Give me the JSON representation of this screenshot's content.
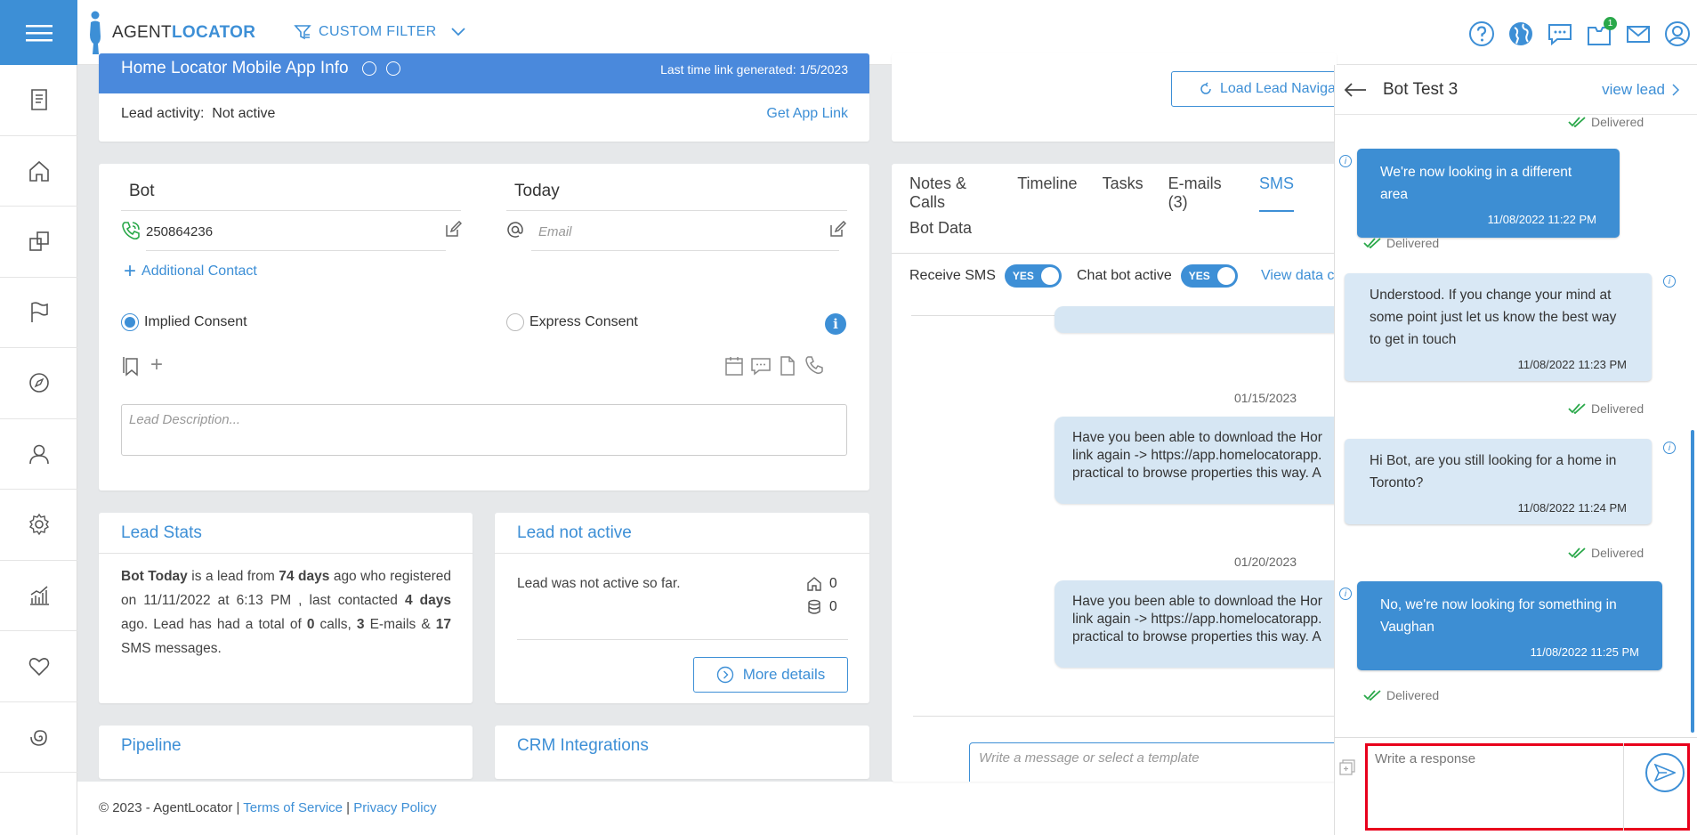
{
  "brand": {
    "part1": "AGENT",
    "part2": "LOCATOR"
  },
  "header": {
    "filter_label": "CUSTOM FILTER",
    "notification_count": "1"
  },
  "app_info": {
    "title": "Home Locator Mobile App Info",
    "last_link": "Last time link generated: 1/5/2023",
    "activity_label": "Lead activity:",
    "activity_value": "Not active",
    "get_link": "Get App Link"
  },
  "contact": {
    "first_name": "Bot",
    "last_name": "Today",
    "phone": "250864236",
    "email_placeholder": "Email",
    "additional_contact": "Additional Contact",
    "implied_consent": "Implied Consent",
    "express_consent": "Express Consent",
    "description_placeholder": "Lead Description..."
  },
  "lead_stats": {
    "title": "Lead Stats",
    "s1": "Bot Today",
    "s2": " is a lead from ",
    "s3": "74 days",
    "s4": " ago who registered on 11/11/2022 at 6:13 PM , last contacted ",
    "s5": "4 days",
    "s6": " ago. Lead has had a total of ",
    "s7": "0",
    "s8": " calls, ",
    "s9": "3",
    "s10": " E-mails & ",
    "s11": "17",
    "s12": " SMS messages."
  },
  "lead_activity": {
    "title": "Lead not active",
    "text": "Lead was not active so far.",
    "home_count": "0",
    "db_count": "0",
    "more_details": "More details"
  },
  "pipeline": {
    "title": "Pipeline"
  },
  "crm": {
    "title": "CRM Integrations"
  },
  "footer": {
    "copyright": "© 2023 - AgentLocator | ",
    "terms": "Terms of Service",
    "sep": " | ",
    "privacy": "Privacy Policy"
  },
  "lead_nav": {
    "button": "Load Lead Navigat"
  },
  "sms_panel": {
    "tabs": [
      "Notes & Calls",
      "Timeline",
      "Tasks",
      "E-mails (3)",
      "SMS"
    ],
    "tab2": "Bot Data",
    "receive_sms": "Receive SMS",
    "chat_bot": "Chat bot active",
    "toggle_label": "YES",
    "view_data": "View data c",
    "date1": "01/15/2023",
    "msg1_l1": "Have you been able to download the Hor",
    "msg1_l2": "link again -> https://app.homelocatorapp.",
    "msg1_l3": "practical to browse properties this way. A",
    "date2": "01/20/2023",
    "msg2_l1": "Have you been able to download the Hor",
    "msg2_l2": "link again -> https://app.homelocatorapp.",
    "msg2_l3": "practical to browse properties this way. A",
    "input_placeholder": "Write a message or select a template"
  },
  "chat": {
    "title": "Bot Test 3",
    "view_lead": "view lead",
    "delivered": "Delivered",
    "messages": [
      {
        "text": "We're now looking in a different area",
        "time": "11/08/2022 11:22 PM"
      },
      {
        "text": "Understood. If you change your mind at some point just let us know the best way to get in touch",
        "time": "11/08/2022 11:23 PM"
      },
      {
        "text": "Hi Bot, are you still looking for a home in Toronto?",
        "time": "11/08/2022 11:24 PM"
      },
      {
        "text": "No, we're now looking for something in Vaughan",
        "time": "11/08/2022 11:25 PM"
      }
    ],
    "response_placeholder": "Write a response"
  },
  "colors": {
    "accent": "#3d8fd6",
    "app_bar": "#4a89dc",
    "highlight": "#e8001c"
  }
}
